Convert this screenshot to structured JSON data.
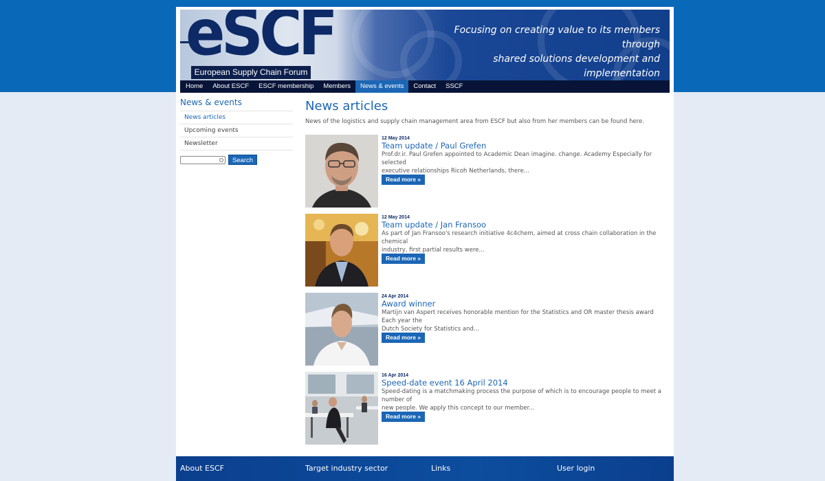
{
  "header": {
    "logo_text": "eSCF",
    "logo_tagline": "European Supply Chain Forum",
    "slogan_line1": "Focusing on creating value to its members through",
    "slogan_line2": "shared solutions development and implementation"
  },
  "nav": {
    "items": [
      {
        "label": "Home"
      },
      {
        "label": "About ESCF"
      },
      {
        "label": "ESCF membership"
      },
      {
        "label": "Members"
      },
      {
        "label": "News & events"
      },
      {
        "label": "Contact"
      },
      {
        "label": "SSCF"
      }
    ],
    "active": "News & events"
  },
  "sidebar": {
    "title": "News & events",
    "links": [
      {
        "label": "News articles"
      },
      {
        "label": "Upcoming events"
      },
      {
        "label": "Newsletter"
      }
    ],
    "search_button": "Search",
    "search_placeholder": ""
  },
  "main": {
    "title": "News articles",
    "intro": "News of the logistics and supply chain management area from ESCF but also from her members can be found here.",
    "read_more_label": "Read more »",
    "articles": [
      {
        "date": "12 May 2014",
        "title": "Team update / Paul Grefen",
        "excerpt_line1": "Prof.dr.ir. Paul Grefen appointed to Academic Dean imagine. change. Academy Especially for selected",
        "excerpt_line2": "executive relationships Ricoh Netherlands, there..."
      },
      {
        "date": "12 May 2014",
        "title": "Team update / Jan Fransoo",
        "excerpt_line1": "As part of Jan Fransoo's research initiative 4c4chem, aimed at cross chain collaboration in the chemical",
        "excerpt_line2": "industry, first partial results were..."
      },
      {
        "date": "24 Apr 2014",
        "title": "Award winner",
        "excerpt_line1": "Martijn van Aspert receives honorable mention for the Statistics and OR master thesis award Each year the",
        "excerpt_line2": "Dutch Society for Statistics and..."
      },
      {
        "date": "16 Apr 2014",
        "title": "Speed-date event 16 April 2014",
        "excerpt_line1": "Speed-dating is a matchmaking process the purpose of which is to encourage people to meet a number of",
        "excerpt_line2": "new people. We apply this concept to our member..."
      }
    ]
  },
  "footer": {
    "columns": [
      {
        "label": "About ESCF"
      },
      {
        "label": "Target industry sector"
      },
      {
        "label": "Links"
      },
      {
        "label": "User login"
      }
    ]
  },
  "colors": {
    "brand_blue": "#1b66b5",
    "top_band": "#0a68b9",
    "nav_dark": "#071437"
  }
}
